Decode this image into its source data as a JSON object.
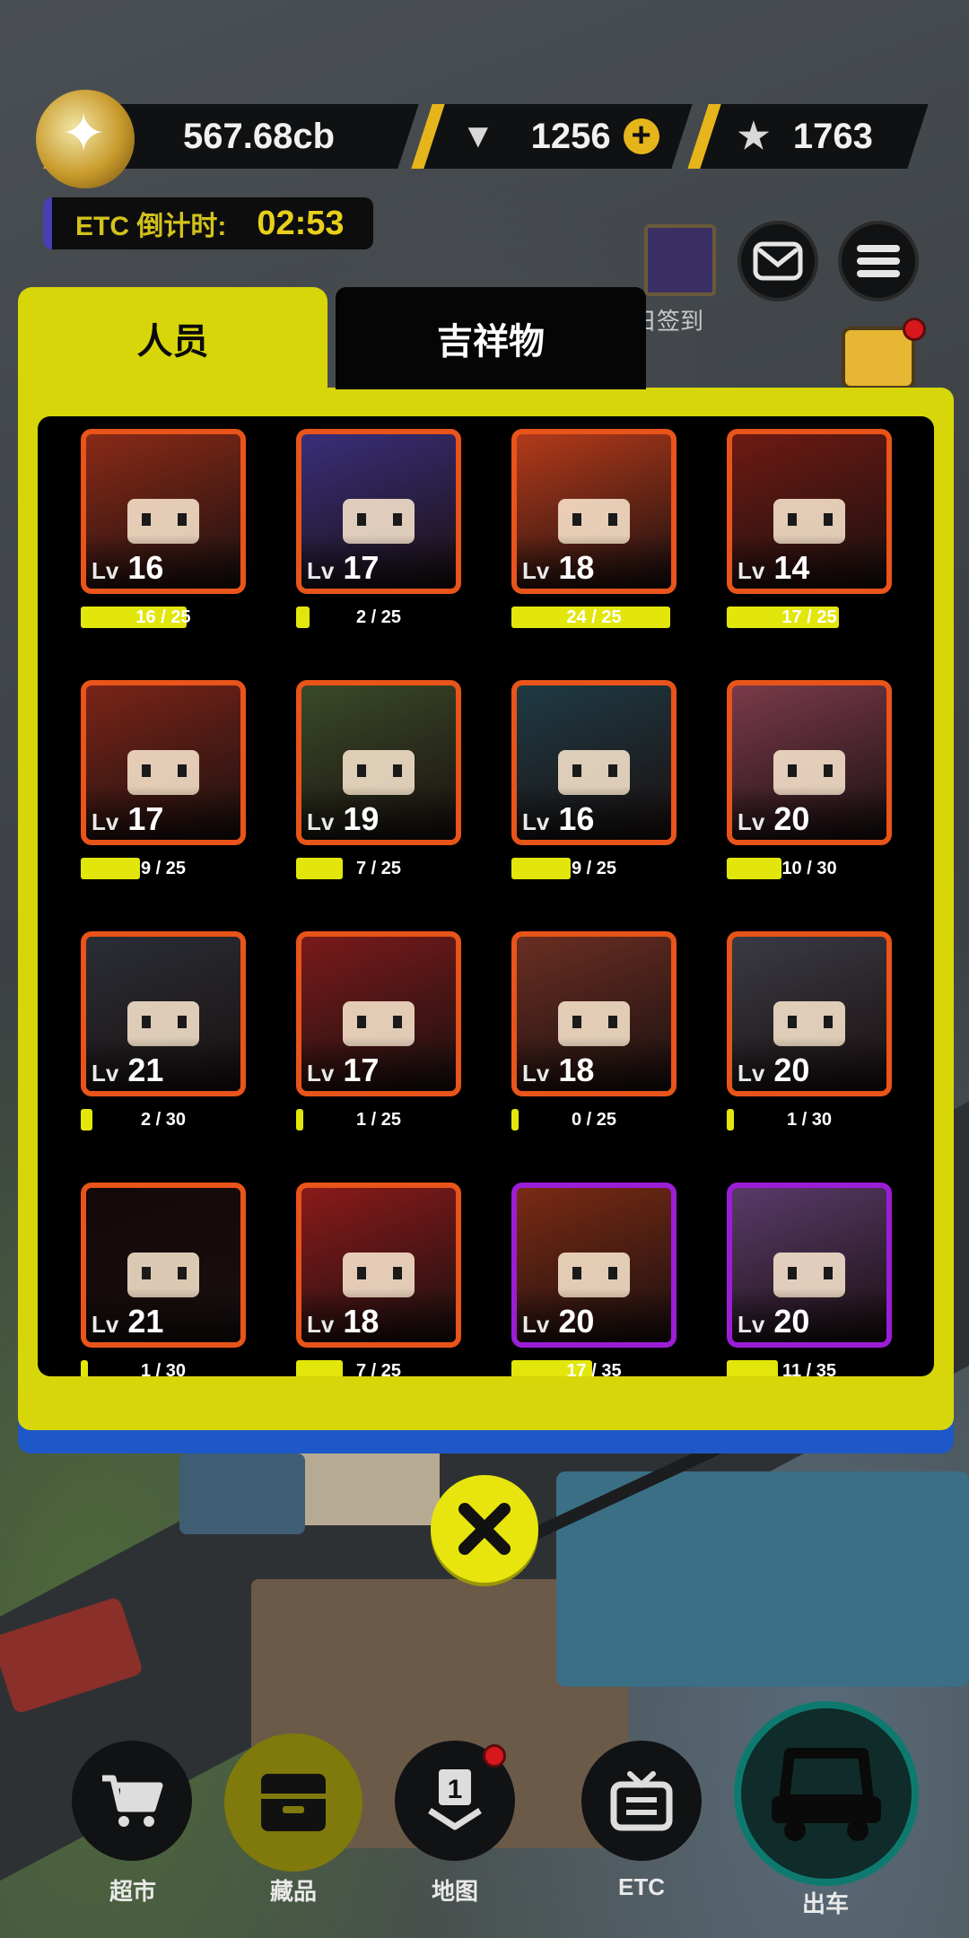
{
  "currency": {
    "coins": "567.68cb",
    "gems": "1256",
    "stars": "1763"
  },
  "etc": {
    "label": "ETC 倒计时:",
    "time": "02:53"
  },
  "signin_label": "明日签到",
  "tabs": [
    {
      "label": "人员",
      "active": true
    },
    {
      "label": "吉祥物",
      "active": false
    }
  ],
  "cards": [
    {
      "level": "16",
      "progress": "16 / 25",
      "fraction": 0.64,
      "frame": "orange",
      "bg": "#8a2a17"
    },
    {
      "level": "17",
      "progress": "2 / 25",
      "fraction": 0.08,
      "frame": "orange",
      "bg": "#3a2e7a"
    },
    {
      "level": "18",
      "progress": "24 / 25",
      "fraction": 0.96,
      "frame": "orange",
      "bg": "#b33a1a"
    },
    {
      "level": "14",
      "progress": "17 / 25",
      "fraction": 0.68,
      "frame": "orange",
      "bg": "#6e1a12"
    },
    {
      "level": "17",
      "progress": "9 / 25",
      "fraction": 0.36,
      "frame": "orange",
      "bg": "#7a2418"
    },
    {
      "level": "19",
      "progress": "7 / 25",
      "fraction": 0.28,
      "frame": "orange",
      "bg": "#3a4a28"
    },
    {
      "level": "16",
      "progress": "9 / 25",
      "fraction": 0.36,
      "frame": "orange",
      "bg": "#1f3a44"
    },
    {
      "level": "20",
      "progress": "10 / 30",
      "fraction": 0.33,
      "frame": "orange",
      "bg": "#7a3a4a"
    },
    {
      "level": "21",
      "progress": "2 / 30",
      "fraction": 0.07,
      "frame": "orange",
      "bg": "#2a2e36"
    },
    {
      "level": "17",
      "progress": "1 / 25",
      "fraction": 0.04,
      "frame": "orange",
      "bg": "#7a1a1a"
    },
    {
      "level": "18",
      "progress": "0 / 25",
      "fraction": 0.0,
      "frame": "orange",
      "bg": "#6a2e22"
    },
    {
      "level": "20",
      "progress": "1 / 30",
      "fraction": 0.03,
      "frame": "orange",
      "bg": "#3a3a44"
    },
    {
      "level": "21",
      "progress": "1 / 30",
      "fraction": 0.03,
      "frame": "orange",
      "bg": "#140808"
    },
    {
      "level": "18",
      "progress": "7 / 25",
      "fraction": 0.28,
      "frame": "orange",
      "bg": "#8a1a1a"
    },
    {
      "level": "20",
      "progress": "17 / 35",
      "fraction": 0.49,
      "frame": "purple",
      "bg": "#7a2a14"
    },
    {
      "level": "20",
      "progress": "11 / 35",
      "fraction": 0.31,
      "frame": "purple",
      "bg": "#5a3a6a"
    }
  ],
  "lv_tag": "Lv",
  "nav": [
    {
      "label": "超市",
      "icon": "cart-icon"
    },
    {
      "label": "藏品",
      "icon": "collection-icon"
    },
    {
      "label": "地图",
      "icon": "map-pin-icon"
    },
    {
      "label": "ETC",
      "icon": "tv-icon"
    },
    {
      "label": "出车",
      "icon": "car-icon"
    }
  ],
  "colors": {
    "accent_yellow": "#d7d60a",
    "frame_orange": "#e85419",
    "frame_purple": "#9b1ed6"
  }
}
